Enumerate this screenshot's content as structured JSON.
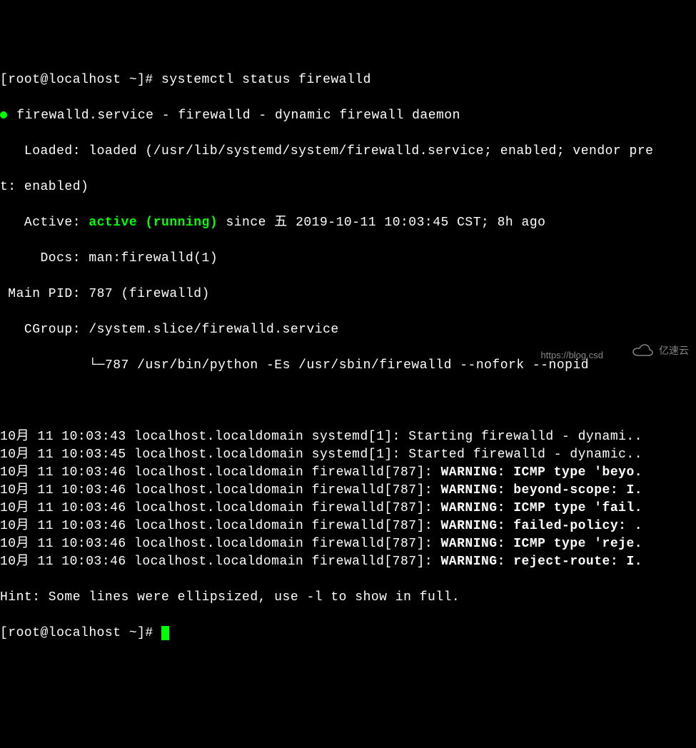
{
  "prompt1": "[root@localhost ~]# ",
  "command": "systemctl status firewalld",
  "service_line": " firewalld.service - firewalld - dynamic firewall daemon",
  "loaded_line": "   Loaded: loaded (/usr/lib/systemd/system/firewalld.service; enabled; vendor pre",
  "loaded_line2": "t: enabled)",
  "active_prefix": "   Active: ",
  "active_status": "active (running)",
  "active_suffix": " since 五 2019-10-11 10:03:45 CST; 8h ago",
  "docs_line": "     Docs: man:firewalld(1)",
  "mainpid_line": " Main PID: 787 (firewalld)",
  "cgroup_line": "   CGroup: /system.slice/firewalld.service",
  "cgroup_child_prefix": "           └─",
  "cgroup_child": "787 /usr/bin/python -Es /usr/sbin/firewalld --nofork --nopid",
  "logs": [
    {
      "prefix": "10月 11 10:03:43 localhost.localdomain systemd[1]: Starting firewalld - dynami..",
      "bold": ""
    },
    {
      "prefix": "10月 11 10:03:45 localhost.localdomain systemd[1]: Started firewalld - dynamic..",
      "bold": ""
    },
    {
      "prefix": "10月 11 10:03:46 localhost.localdomain firewalld[787]: ",
      "bold": "WARNING: ICMP type 'beyo."
    },
    {
      "prefix": "10月 11 10:03:46 localhost.localdomain firewalld[787]: ",
      "bold": "WARNING: beyond-scope: I."
    },
    {
      "prefix": "10月 11 10:03:46 localhost.localdomain firewalld[787]: ",
      "bold": "WARNING: ICMP type 'fail."
    },
    {
      "prefix": "10月 11 10:03:46 localhost.localdomain firewalld[787]: ",
      "bold": "WARNING: failed-policy: ."
    },
    {
      "prefix": "10月 11 10:03:46 localhost.localdomain firewalld[787]: ",
      "bold": "WARNING: ICMP type 'reje."
    },
    {
      "prefix": "10月 11 10:03:46 localhost.localdomain firewalld[787]: ",
      "bold": "WARNING: reject-route: I."
    }
  ],
  "hint": "Hint: Some lines were ellipsized, use -l to show in full.",
  "prompt2": "[root@localhost ~]# ",
  "watermark_url": "https://blog.csd",
  "watermark_brand": "亿速云"
}
